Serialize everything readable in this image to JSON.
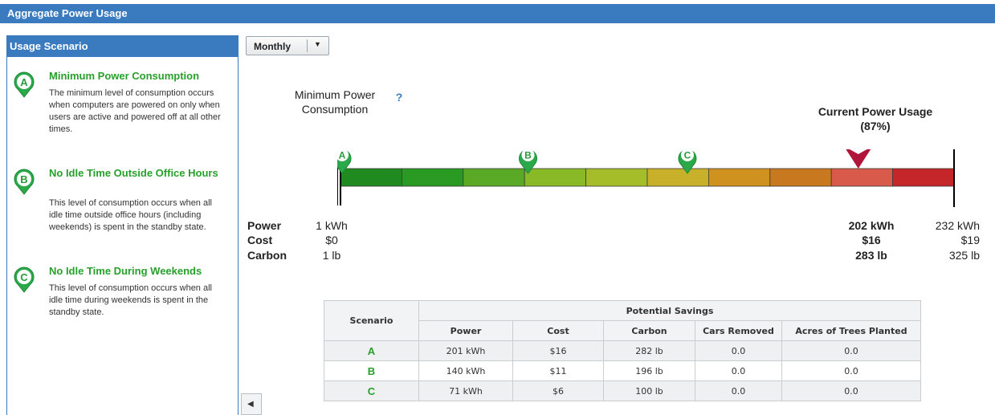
{
  "header": {
    "title": "Aggregate Power Usage"
  },
  "sidebar": {
    "title": "Usage Scenario",
    "scenarios": [
      {
        "letter": "A",
        "title": "Minimum Power Consumption",
        "description": "The minimum level of consumption occurs when computers are powered on only when users are active and powered off at all other times."
      },
      {
        "letter": "B",
        "title": "No Idle Time Outside Office Hours",
        "description": "This level of consumption occurs when all idle time outside office hours (including weekends) is spent in the standby state."
      },
      {
        "letter": "C",
        "title": "No Idle Time During Weekends",
        "description": "This level of consumption occurs when all idle time during weekends is spent in the standby state."
      }
    ]
  },
  "controls": {
    "period": "Monthly"
  },
  "gauge": {
    "min_label": "Minimum Power Consumption",
    "current_label": "Current Power Usage",
    "current_percent": "(87%)",
    "current_fraction": 0.87,
    "segment_colors": [
      "#1f8a1f",
      "#2a9b22",
      "#5aa926",
      "#8ab928",
      "#a6bd2a",
      "#c9b02a",
      "#d0921f",
      "#c8781e",
      "#d75a4a",
      "#c4262a"
    ],
    "markers": [
      {
        "letter": "A",
        "kwh": 1
      },
      {
        "letter": "B",
        "kwh": 71
      },
      {
        "letter": "C",
        "kwh": 131
      }
    ],
    "min_kwh": 1,
    "max_kwh": 232,
    "current_kwh": 202
  },
  "metrics": {
    "labels": {
      "power": "Power",
      "cost": "Cost",
      "carbon": "Carbon"
    },
    "min": {
      "power": "1 kWh",
      "cost": "$0",
      "carbon": "1 lb"
    },
    "current": {
      "power": "202 kWh",
      "cost": "$16",
      "carbon": "283 lb"
    },
    "max": {
      "power": "232 kWh",
      "cost": "$19",
      "carbon": "325 lb"
    }
  },
  "savings_table": {
    "scenario_header": "Scenario",
    "group_header": "Potential Savings",
    "columns": [
      "Power",
      "Cost",
      "Carbon",
      "Cars Removed",
      "Acres of Trees Planted"
    ],
    "rows": [
      {
        "scenario": "A",
        "power": "201 kWh",
        "cost": "$16",
        "carbon": "282 lb",
        "cars": "0.0",
        "acres": "0.0"
      },
      {
        "scenario": "B",
        "power": "140 kWh",
        "cost": "$11",
        "carbon": "196 lb",
        "cars": "0.0",
        "acres": "0.0"
      },
      {
        "scenario": "C",
        "power": "71 kWh",
        "cost": "$6",
        "carbon": "100 lb",
        "cars": "0.0",
        "acres": "0.0"
      }
    ]
  },
  "icons": {
    "marker": "scenario-pin-icon",
    "help": "help-question-icon",
    "current": "current-usage-arrow-icon",
    "dropdown": "chevron-down-icon",
    "prev": "left-arrow-icon"
  },
  "colors": {
    "accent": "#3a7bc0",
    "scenario_green": "#27a02b",
    "current_marker": "#b0163a"
  }
}
